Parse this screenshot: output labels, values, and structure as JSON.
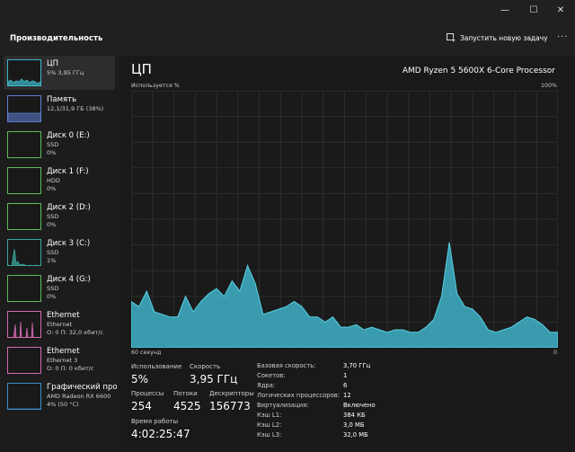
{
  "window": {
    "controls": {
      "minimize": "—",
      "maximize": "☐",
      "close": "✕"
    }
  },
  "header": {
    "title": "Производительность",
    "run_task": "Запустить новую задачу",
    "more": "···"
  },
  "sidebar": {
    "items": [
      {
        "name": "ЦП",
        "sub1": "5% 3,95 ГГц",
        "sub2": "",
        "color": "#40b8cc"
      },
      {
        "name": "Память",
        "sub1": "12,1/31,9 ГБ (38%)",
        "sub2": "",
        "color": "#5d7fd6"
      },
      {
        "name": "Диск 0 (E:)",
        "sub1": "SSD",
        "sub2": "0%",
        "color": "#5fbb5b"
      },
      {
        "name": "Диск 1 (F:)",
        "sub1": "HDD",
        "sub2": "0%",
        "color": "#5fbb5b"
      },
      {
        "name": "Диск 2 (D:)",
        "sub1": "SSD",
        "sub2": "0%",
        "color": "#5fbb5b"
      },
      {
        "name": "Диск 3 (C:)",
        "sub1": "SSD",
        "sub2": "1%",
        "color": "#3aa89a"
      },
      {
        "name": "Диск 4 (G:)",
        "sub1": "SSD",
        "sub2": "0%",
        "color": "#5fbb5b"
      },
      {
        "name": "Ethernet",
        "sub1": "Ethernet",
        "sub2": "О: 0 П: 32,0 кбит/с",
        "color": "#d46ab0"
      },
      {
        "name": "Ethernet",
        "sub1": "Ethernet 3",
        "sub2": "О: 0 П: 0 кбит/с",
        "color": "#d46ab0"
      },
      {
        "name": "Графический про",
        "sub1": "AMD Radeon RX 6600",
        "sub2": "4% (50 °C)",
        "color": "#3a8ec8"
      }
    ]
  },
  "cpu": {
    "title": "ЦП",
    "model": "AMD Ryzen 5 5600X 6-Core Processor",
    "axis_label": "Используется %",
    "axis_max": "100%",
    "axis_time": "60 секунд",
    "axis_min": "0",
    "graph_color": "#3fb3c8",
    "usage_history_percent": [
      18,
      16,
      22,
      14,
      13,
      12,
      12,
      20,
      14,
      18,
      21,
      23,
      20,
      26,
      22,
      32,
      25,
      13,
      14,
      15,
      16,
      18,
      16,
      12,
      12,
      10,
      12,
      8,
      8,
      9,
      7,
      8,
      7,
      6,
      7,
      7,
      6,
      6,
      8,
      11,
      20,
      41,
      21,
      16,
      15,
      12,
      7,
      6,
      7,
      8,
      10,
      12,
      11,
      9,
      6,
      6
    ]
  },
  "stats": {
    "utilization": {
      "label": "Использование",
      "value": "5%"
    },
    "speed": {
      "label": "Скорость",
      "value": "3,95 ГГц"
    },
    "processes": {
      "label": "Процессы",
      "value": "254"
    },
    "threads": {
      "label": "Потоки",
      "value": "4525"
    },
    "handles": {
      "label": "Дескрипторы",
      "value": "156773"
    },
    "uptime": {
      "label": "Время работы",
      "value": "4:02:25:47"
    }
  },
  "info": [
    {
      "label": "Базовая скорость:",
      "value": "3,70 ГГц"
    },
    {
      "label": "Сокетов:",
      "value": "1"
    },
    {
      "label": "Ядра:",
      "value": "6"
    },
    {
      "label": "Логических процессоров:",
      "value": "12"
    },
    {
      "label": "Виртуализация:",
      "value": "Включено"
    },
    {
      "label": "Кэш L1:",
      "value": "384 КБ"
    },
    {
      "label": "Кэш L2:",
      "value": "3,0 МБ"
    },
    {
      "label": "Кэш L3:",
      "value": "32,0 МБ"
    }
  ]
}
